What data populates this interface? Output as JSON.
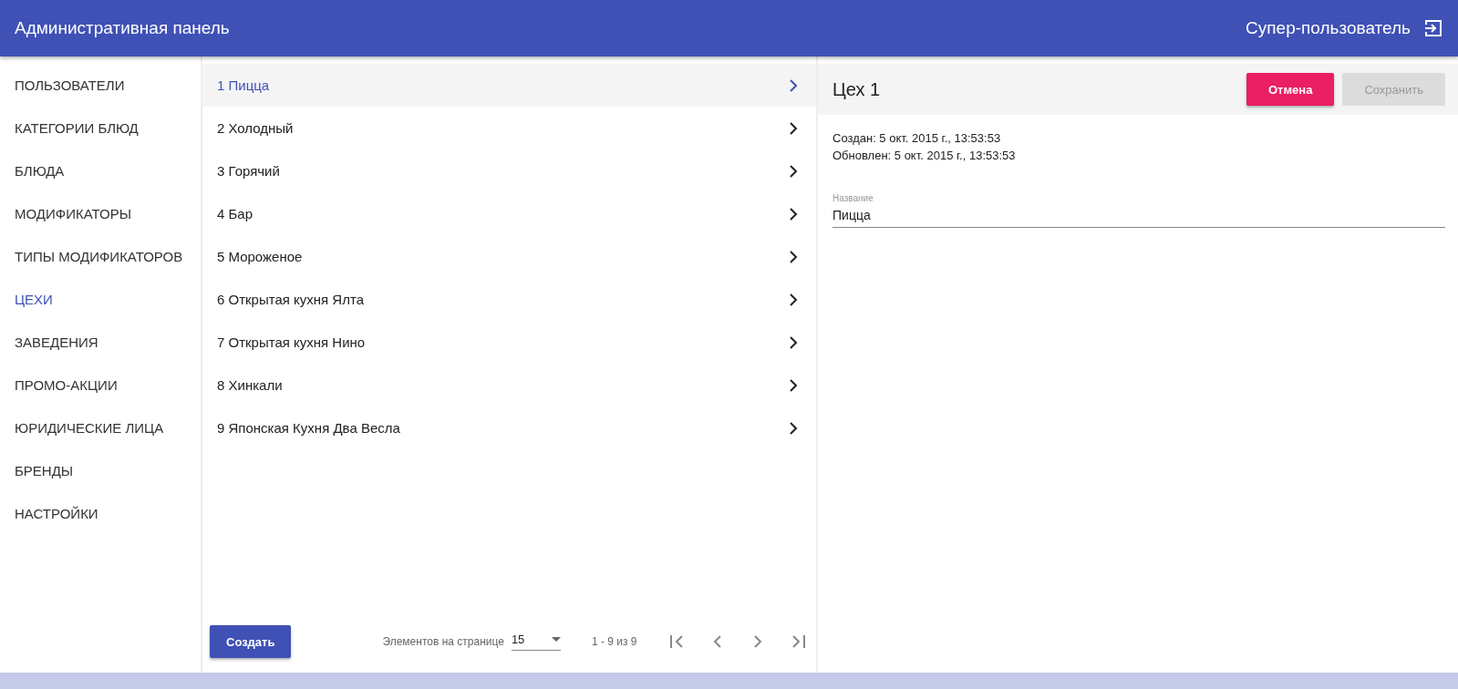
{
  "header": {
    "title": "Административная панель",
    "user": "Супер-пользователь"
  },
  "sidebar": {
    "items": [
      {
        "label": "ПОЛЬЗОВАТЕЛИ",
        "selected": false
      },
      {
        "label": "КАТЕГОРИИ БЛЮД",
        "selected": false
      },
      {
        "label": "БЛЮДА",
        "selected": false
      },
      {
        "label": "МОДИФИКАТОРЫ",
        "selected": false
      },
      {
        "label": "ТИПЫ МОДИФИКАТОРОВ",
        "selected": false
      },
      {
        "label": "ЦЕХИ",
        "selected": true
      },
      {
        "label": "ЗАВЕДЕНИЯ",
        "selected": false
      },
      {
        "label": "ПРОМО-АКЦИИ",
        "selected": false
      },
      {
        "label": "ЮРИДИЧЕСКИЕ ЛИЦА",
        "selected": false
      },
      {
        "label": "БРЕНДЫ",
        "selected": false
      },
      {
        "label": "НАСТРОЙКИ",
        "selected": false
      }
    ]
  },
  "list": {
    "rows": [
      {
        "label": "1 Пицца",
        "selected": true
      },
      {
        "label": "2 Холодный",
        "selected": false
      },
      {
        "label": "3 Горячий",
        "selected": false
      },
      {
        "label": "4 Бар",
        "selected": false
      },
      {
        "label": "5 Мороженое",
        "selected": false
      },
      {
        "label": "6 Открытая кухня Ялта",
        "selected": false
      },
      {
        "label": "7 Открытая кухня Нино",
        "selected": false
      },
      {
        "label": "8 Хинкали",
        "selected": false
      },
      {
        "label": "9 Японская Кухня Два Весла",
        "selected": false
      }
    ],
    "create_button": "Создать",
    "paginator": {
      "page_size_label": "Элементов на странице",
      "page_size": "15",
      "range": "1 - 9 из 9"
    }
  },
  "detail": {
    "title": "Цех 1",
    "buttons": [
      {
        "label": "Отмена",
        "disabled": false
      },
      {
        "label": "Сохранить",
        "disabled": true
      }
    ],
    "created": "Создан: 5 окт. 2015 г., 13:53:53",
    "updated": "Обновлен: 5 окт. 2015 г., 13:53:53",
    "field": {
      "label": "Название",
      "value": "Пицца"
    }
  }
}
